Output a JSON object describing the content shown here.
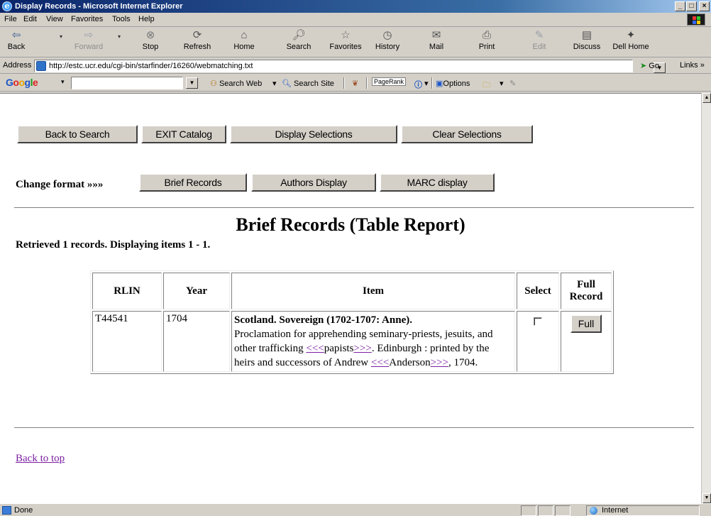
{
  "window": {
    "title": "Display Records - Microsoft Internet Explorer",
    "controls": [
      "_",
      "&#x25A1;",
      "×"
    ]
  },
  "menu": [
    "File",
    "Edit",
    "View",
    "Favorites",
    "Tools",
    "Help"
  ],
  "toolbar": {
    "back": "Back",
    "forward": "Forward",
    "stop": "Stop",
    "refresh": "Refresh",
    "home": "Home",
    "search": "Search",
    "favorites": "Favorites",
    "history": "History",
    "mail": "Mail",
    "print": "Print",
    "edit": "Edit",
    "discuss": "Discuss",
    "dell_home": "Dell Home"
  },
  "address": {
    "label": "Address",
    "url": "http://estc.ucr.edu/cgi-bin/starfinder/16260/webmatching.txt",
    "go": "Go",
    "links": "Links »"
  },
  "google_bar": {
    "logo": "Google",
    "search_value": "",
    "search_web": "Search Web",
    "search_site": "Search Site",
    "pagerank": "PageRank",
    "options": "Options"
  },
  "page": {
    "buttons_row1": [
      "Back to Search",
      "EXIT Catalog",
      "Display Selections",
      "Clear Selections"
    ],
    "change_format_label": "Change format »»»",
    "buttons_row2": [
      "Brief Records",
      "Authors Display",
      "MARC display"
    ],
    "title": "Brief Records (Table Report)",
    "retrieved": "Retrieved 1 records. Displaying items 1 - 1.",
    "table": {
      "headers": [
        "RLIN",
        "Year",
        "Item",
        "Select",
        "Full Record"
      ],
      "rows": [
        {
          "rlin": "T44541",
          "year": "1704",
          "item_heading": "Scotland. Sovereign (1702-1707: Anne).",
          "item_text_1": "Proclamation for apprehending seminary-priests, jesuits, and other trafficking ",
          "link_prev_1": "<<<",
          "keyword_1": "papists",
          "link_next_1": ">>>",
          "item_text_2": ". Edinburgh : printed by the heirs and successors of Andrew ",
          "link_prev_2": "<<<",
          "keyword_2": "Anderson",
          "link_next_2": ">>>",
          "item_text_3": ", 1704.",
          "selected": false,
          "full_button": "Full"
        }
      ]
    },
    "back_to_top": "Back to top"
  },
  "status": {
    "text": "Done",
    "zone": "Internet"
  }
}
